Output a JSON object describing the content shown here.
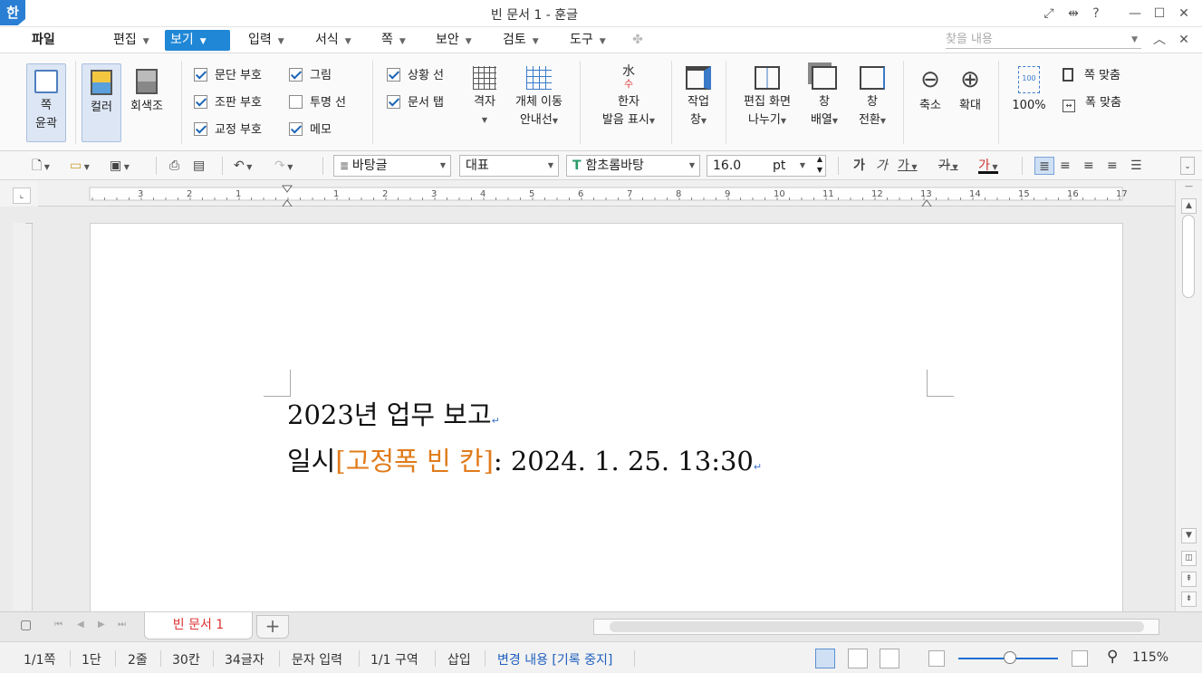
{
  "app": {
    "logo": "한",
    "window_title": "빈 문서 1 - 훈글"
  },
  "window_controls": {
    "help": "?"
  },
  "menu": {
    "file": "파일",
    "items": [
      {
        "label": "편집",
        "active": false
      },
      {
        "label": "보기",
        "active": true
      },
      {
        "label": "입력",
        "active": false
      },
      {
        "label": "서식",
        "active": false
      },
      {
        "label": "쪽",
        "active": false
      },
      {
        "label": "보안",
        "active": false
      },
      {
        "label": "검토",
        "active": false
      },
      {
        "label": "도구",
        "active": false
      }
    ],
    "search_placeholder": "찾을 내용"
  },
  "ribbon": {
    "page_outline": [
      "쪽",
      "윤곽"
    ],
    "color": "컬러",
    "grayscale": "회색조",
    "checks": [
      {
        "label": "문단 부호",
        "checked": true
      },
      {
        "label": "조판 부호",
        "checked": true
      },
      {
        "label": "교정 부호",
        "checked": true
      },
      {
        "label": "그림",
        "checked": true
      },
      {
        "label": "투명 선",
        "checked": false
      },
      {
        "label": "메모",
        "checked": true
      },
      {
        "label": "상황 선",
        "checked": true
      },
      {
        "label": "문서 탭",
        "checked": true
      }
    ],
    "grid": "격자",
    "object_guide": [
      "개체 이동",
      "안내선"
    ],
    "hanja": [
      "한자",
      "발음 표시"
    ],
    "task_pane": [
      "작업",
      "창"
    ],
    "split_view": [
      "편집 화면",
      "나누기"
    ],
    "arrange": [
      "창",
      "배열"
    ],
    "switch": [
      "창",
      "전환"
    ],
    "zoom_out": "축소",
    "zoom_in": "확대",
    "zoom_100": "100%",
    "fit_page": "쪽 맞춤",
    "fit_width": "폭 맞춤"
  },
  "formatbar": {
    "style": "바탕글",
    "lang": "대표",
    "font": "함초롬바탕",
    "size": "16.0",
    "unit": "pt"
  },
  "ruler": {
    "h_labels": [
      "3",
      "2",
      "1",
      "1",
      "2",
      "3",
      "4",
      "5",
      "6",
      "7",
      "8",
      "9",
      "10",
      "11",
      "12",
      "13",
      "14",
      "15",
      "16",
      "17"
    ]
  },
  "document": {
    "line1": "2023년 업무 보고",
    "line2_prefix": "일시",
    "field": "[고정폭 빈 칸]",
    "line2_suffix": ": 2024. 1. 25. 13:30"
  },
  "tabs": {
    "doc_tab": "빈 문서 1",
    "add": "+"
  },
  "status": {
    "page": "1/1쪽",
    "column": "1단",
    "line": "2줄",
    "col_pos": "30칸",
    "chars": "34글자",
    "mode": "문자 입력",
    "section": "1/1 구역",
    "insert": "삽입",
    "track": "변경 내용 [기록 중지]",
    "zoom": "115%"
  }
}
